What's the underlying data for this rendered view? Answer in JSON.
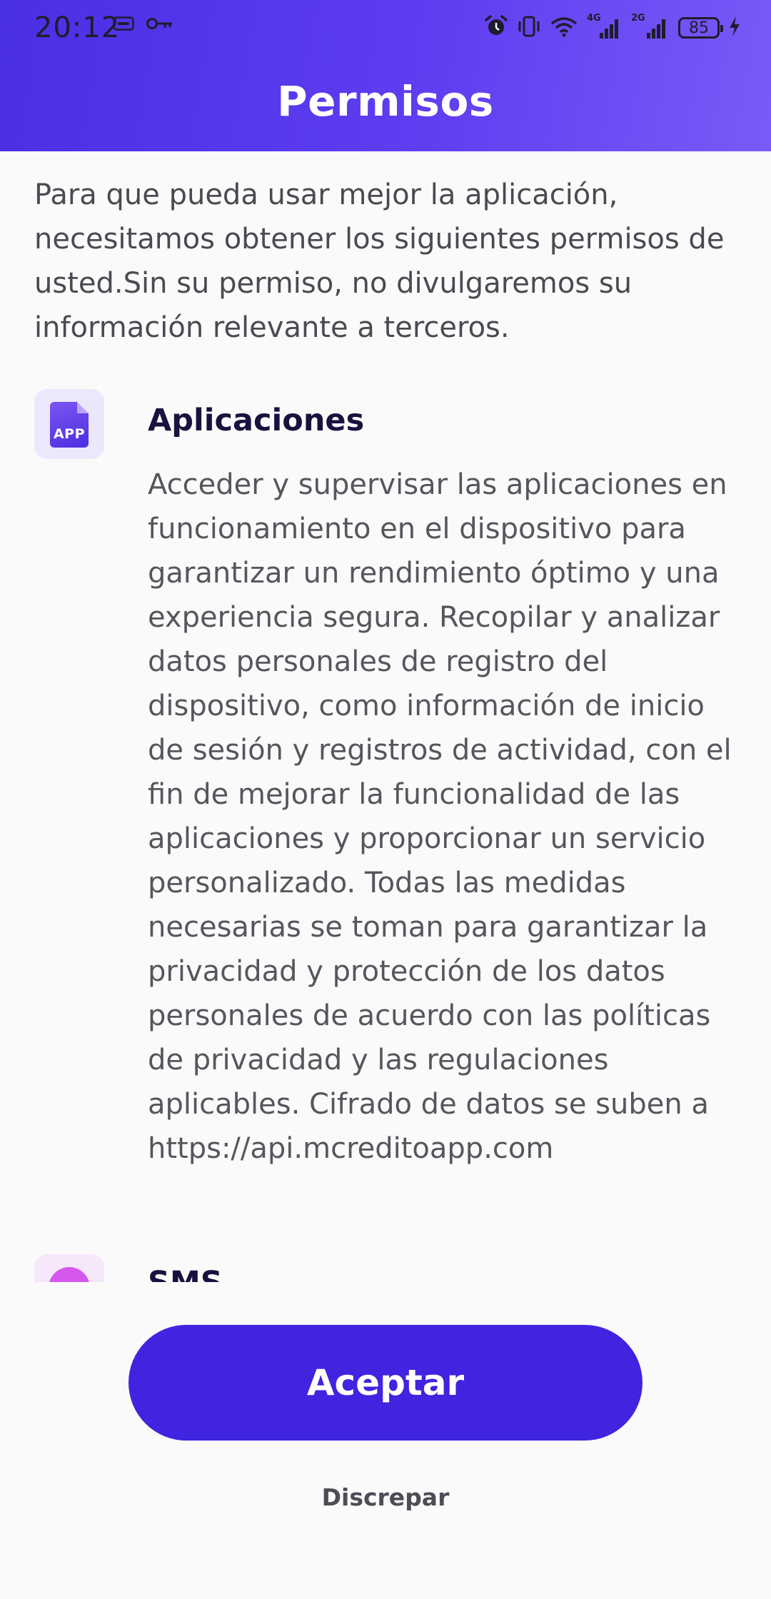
{
  "status_bar": {
    "time": "20:12",
    "battery": "85",
    "left_icons": [
      "hd-icon",
      "key-icon"
    ],
    "right_icons": [
      "alarm-icon",
      "vibrate-icon",
      "wifi-icon",
      "signal-4g-icon",
      "signal-2g-icon",
      "battery-icon",
      "charging-icon"
    ],
    "signal_labels": [
      "4G",
      "2G"
    ]
  },
  "header": {
    "title": "Permisos"
  },
  "intro": "Para que pueda usar mejor la aplicación, necesitamos obtener los siguientes permisos de usted.Sin su permiso, no divulgaremos su información relevante a terceros.",
  "permissions": [
    {
      "icon": "app-icon",
      "icon_label": "APP",
      "title": "Aplicaciones",
      "description": "Acceder y supervisar las aplicaciones en funcionamiento en el dispositivo para garantizar un rendimiento óptimo y una experiencia segura. Recopilar y analizar datos personales de registro del dispositivo, como información de inicio de sesión y registros de actividad, con el fin de mejorar la funcionalidad de las aplicaciones y proporcionar un servicio personalizado. Todas las medidas necesarias se toman para garantizar la privacidad y protección de los datos personales de acuerdo con las políticas de privacidad y las regulaciones aplicables. Cifrado de datos se suben a https://api.mcreditoapp.com"
    },
    {
      "icon": "sms-icon",
      "title": "SMS"
    }
  ],
  "actions": {
    "accept": "Aceptar",
    "decline": "Discrepar"
  },
  "colors": {
    "header_gradient_start": "#4a2fe4",
    "header_gradient_end": "#7a5af8",
    "accent": "#4024df",
    "title_text": "#18123f",
    "body_text": "#56565e",
    "sms_accent": "#d657ee"
  }
}
